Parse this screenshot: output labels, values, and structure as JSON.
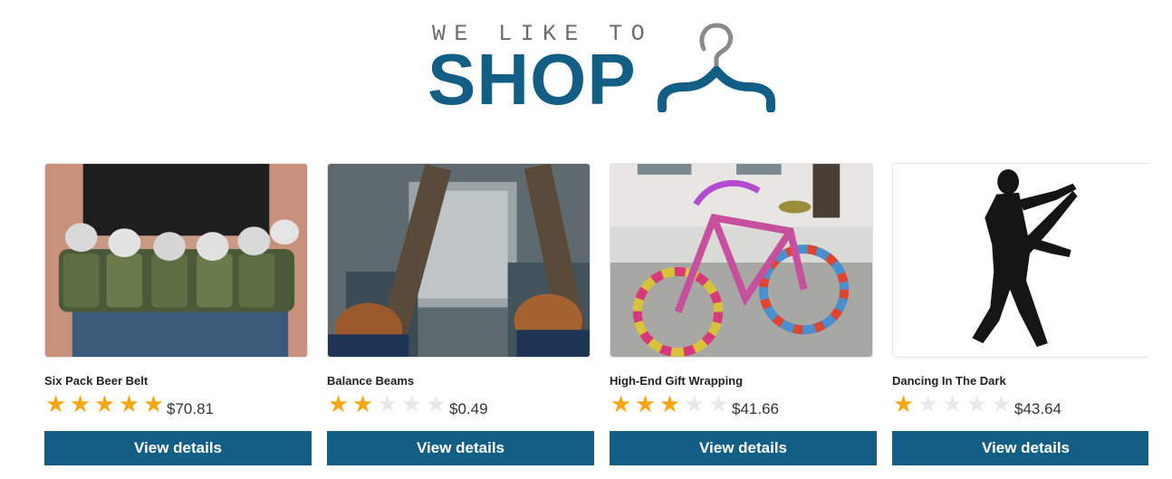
{
  "logo": {
    "tagline": "WE LIKE TO",
    "word": "SHOP",
    "icon": "hanger-icon",
    "brand_color": "#135e84",
    "tagline_color": "#6b6b6b"
  },
  "products": [
    {
      "title": "Six Pack Beer Belt",
      "rating": 5,
      "rating_max": 5,
      "price": "$70.81",
      "button_label": "View details",
      "image": "beer-belt-image"
    },
    {
      "title": "Balance Beams",
      "rating": 2,
      "rating_max": 5,
      "price": "$0.49",
      "button_label": "View details",
      "image": "balance-beams-image"
    },
    {
      "title": "High-End Gift Wrapping",
      "rating": 3,
      "rating_max": 5,
      "price": "$41.66",
      "button_label": "View details",
      "image": "gift-wrapped-bicycle-image"
    },
    {
      "title": "Dancing In The Dark",
      "rating": 1,
      "rating_max": 5,
      "price": "$43.64",
      "button_label": "View details",
      "image": "dancing-silhouette-image"
    }
  ],
  "colors": {
    "button": "#135e84",
    "star_on": "#f3a712",
    "star_off": "#e6eaed"
  }
}
